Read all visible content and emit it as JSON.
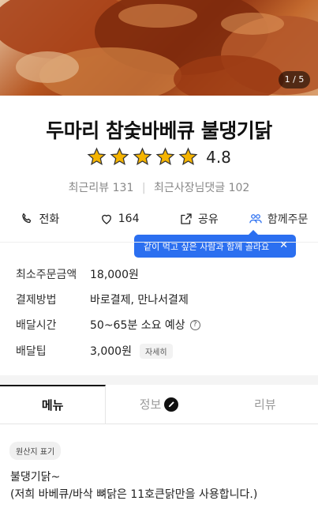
{
  "hero": {
    "pager": "1 / 5"
  },
  "store": {
    "name": "두마리 참숯바베큐 불댕기닭",
    "rating": "4.8",
    "stars_filled": 5,
    "recent_reviews_label": "최근리뷰 131",
    "owner_replies_label": "최근사장님댓글 102"
  },
  "actions": {
    "call": "전화",
    "like_count": "164",
    "share": "공유",
    "group_order": "함께주문"
  },
  "tooltip": {
    "text": "같이 먹고 싶은 사람과 함께 골라요",
    "close": "✕"
  },
  "info": {
    "min_order_label": "최소주문금액",
    "min_order_value": "18,000원",
    "payment_label": "결제방법",
    "payment_value": "바로결제, 만나서결제",
    "delivery_time_label": "배달시간",
    "delivery_time_value": "50~65분 소요 예상",
    "tip_label": "배달팁",
    "tip_value": "3,000원",
    "tip_detail": "자세히"
  },
  "tabs": {
    "menu": "메뉴",
    "info": "정보",
    "review": "리뷰"
  },
  "menu": {
    "origin_badge": "원산지 표기",
    "line1": "불댕기닭~",
    "line2": "(저희 바베큐/바삭 뼈닭은 11호큰닭만을 사용합니다.)"
  },
  "colors": {
    "accent_blue": "#2b6ff0",
    "star": "#f5b400"
  }
}
